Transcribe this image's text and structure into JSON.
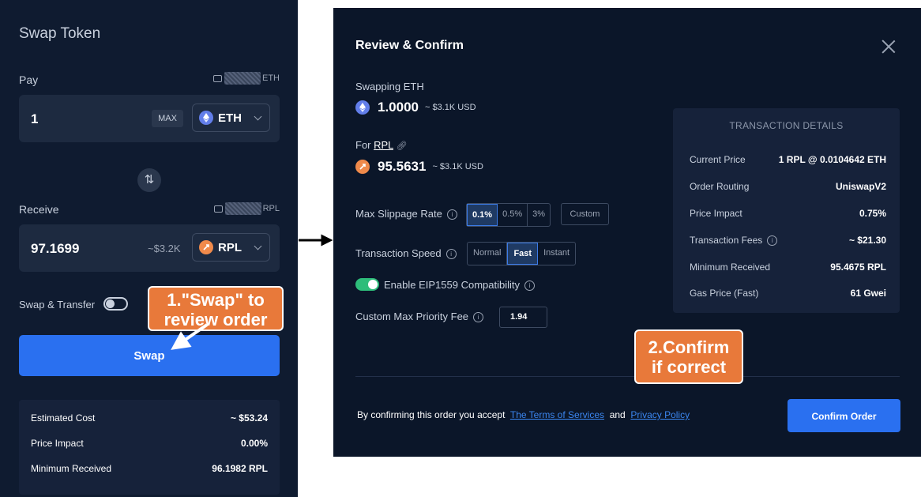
{
  "swap_panel": {
    "title": "Swap Token",
    "pay": {
      "label": "Pay",
      "wallet_token": "ETH",
      "amount": "1",
      "max_label": "MAX",
      "token": "ETH"
    },
    "receive": {
      "label": "Receive",
      "wallet_token": "RPL",
      "amount": "97.1699",
      "usd_estimate": "~$3.2K",
      "token": "RPL"
    },
    "swap_transfer_label": "Swap & Transfer",
    "swap_transfer_enabled": false,
    "swap_button": "Swap",
    "summary": [
      {
        "label": "Estimated Cost",
        "value": "~ $53.24"
      },
      {
        "label": "Price Impact",
        "value": "0.00%"
      },
      {
        "label": "Minimum Received",
        "value": "96.1982 RPL"
      }
    ]
  },
  "callouts": {
    "step1_line1": "1.\"Swap\" to",
    "step1_line2": "review order",
    "step2_line1": "2.Confirm",
    "step2_line2": "if correct"
  },
  "review_modal": {
    "title": "Review & Confirm",
    "swapping_label": "Swapping ETH",
    "swapping_amount": "1.0000",
    "swapping_usd": "~ $3.1K USD",
    "for_label": "For",
    "for_token_link": "RPL",
    "for_amount": "95.5631",
    "for_usd": "~ $3.1K USD",
    "slippage_label": "Max Slippage Rate",
    "slippage_options": [
      "0.1%",
      "0.5%",
      "3%"
    ],
    "slippage_selected": "0.1%",
    "slippage_custom": "Custom",
    "speed_label": "Transaction Speed",
    "speed_options": [
      "Normal",
      "Fast",
      "Instant"
    ],
    "speed_selected": "Fast",
    "eip1559_label": "Enable EIP1559 Compatibility",
    "eip1559_enabled": true,
    "priority_fee_label": "Custom Max Priority Fee",
    "priority_fee_value": "1.94",
    "details": {
      "title": "TRANSACTION DETAILS",
      "rows": [
        {
          "label": "Current Price",
          "value": "1 RPL @ 0.0104642 ETH"
        },
        {
          "label": "Order Routing",
          "value": "UniswapV2"
        },
        {
          "label": "Price Impact",
          "value": "0.75%"
        },
        {
          "label": "Transaction Fees",
          "value": "~ $21.30"
        },
        {
          "label": "Minimum Received",
          "value": "95.4675 RPL"
        },
        {
          "label": "Gas Price (Fast)",
          "value": "61 Gwei"
        }
      ]
    },
    "terms_prefix": "By confirming this order you accept",
    "terms_link": "The Terms of Services",
    "terms_and": "and",
    "privacy_link": "Privacy Policy",
    "confirm_button": "Confirm Order"
  },
  "colors": {
    "accent_blue": "#2a70f0",
    "callout_orange": "#e8793a",
    "toggle_green": "#2ebd7a",
    "eth_icon": "#627eea",
    "rpl_icon": "#f08a4b"
  }
}
